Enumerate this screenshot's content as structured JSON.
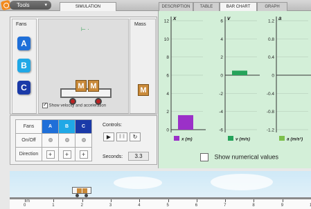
{
  "toolbar": {
    "tools_label": "Tools"
  },
  "tabs": [
    {
      "label": "SIMULATION",
      "active": true
    },
    {
      "label": "DESCRIPTION",
      "active": false
    },
    {
      "label": "TABLE",
      "active": false
    },
    {
      "label": "BAR CHART",
      "active": false
    },
    {
      "label": "GRAPH",
      "active": false
    }
  ],
  "sim": {
    "fans_title": "Fans",
    "mass_title": "Mass",
    "fans": [
      {
        "label": "A",
        "color": "#1f6fd8"
      },
      {
        "label": "B",
        "color": "#20a8e6"
      },
      {
        "label": "C",
        "color": "#1a3aa8"
      }
    ],
    "mass_blocks": [
      "M",
      "M"
    ],
    "mass_tile": "M",
    "show_velocity_label": "Show velocity and acceleration",
    "show_velocity_checked": true
  },
  "controls": {
    "table_headers": [
      "Fans",
      "A",
      "B",
      "C"
    ],
    "onoff_label": "On/Off",
    "direction_label": "Direction",
    "plus": "+",
    "controls_label": "Controls:",
    "play": "▶",
    "pause": "❚❚",
    "reset": "↻",
    "seconds_label": "Seconds:",
    "seconds_value": "3.3"
  },
  "chart_data": [
    {
      "type": "bar",
      "ylabel": "x",
      "legend": "x (m)",
      "color": "#9b30c8",
      "ylim": [
        0,
        12
      ],
      "ticks": [
        0,
        2,
        4,
        6,
        8,
        10,
        12
      ],
      "value": 1.6
    },
    {
      "type": "bar",
      "ylabel": "v",
      "legend": "v (m/s)",
      "color": "#25a35a",
      "ylim": [
        -6,
        6
      ],
      "ticks": [
        -6,
        -4,
        -2,
        0,
        2,
        4,
        6
      ],
      "value": 0.5
    },
    {
      "type": "bar",
      "ylabel": "a",
      "legend": "a (m/s²)",
      "color": "#7cc04b",
      "ylim": [
        -1.2,
        1.2
      ],
      "ticks": [
        "-1.2",
        "-0.8",
        "-0.4",
        "0",
        "0.4",
        "0.8",
        "1.2"
      ],
      "value": 0
    }
  ],
  "chart_footer": {
    "show_numerical_label": "Show numerical values",
    "checked": false
  },
  "track": {
    "unit": "m",
    "ticks": [
      "0",
      "1",
      "2",
      "3",
      "4",
      "5",
      "6",
      "7",
      "8",
      "9",
      "10"
    ],
    "cart_position": 1.6
  }
}
